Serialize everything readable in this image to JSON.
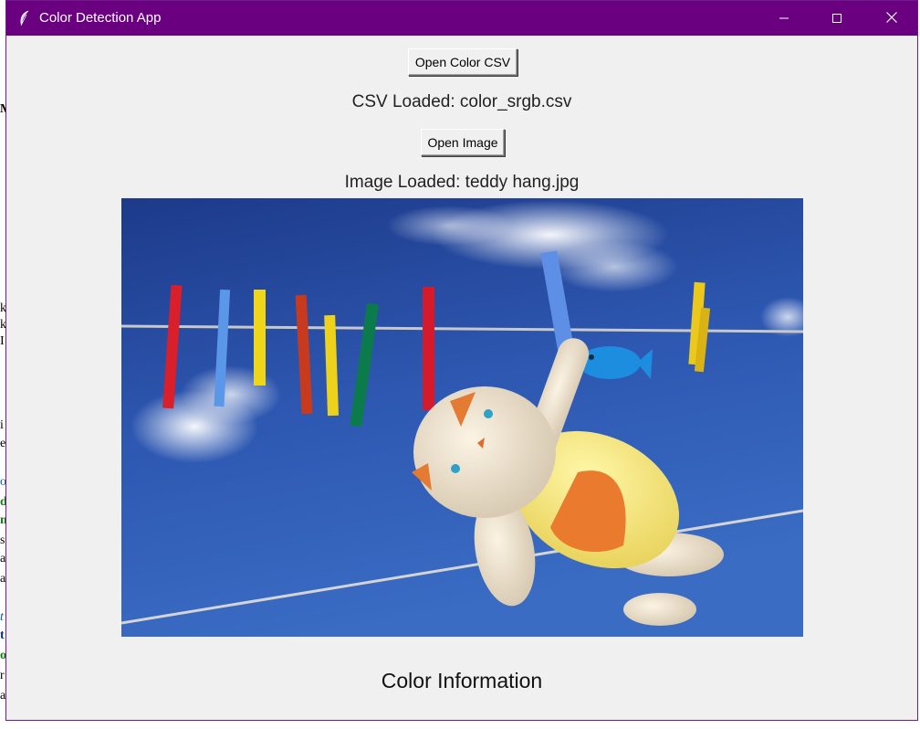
{
  "window": {
    "title": "Color Detection App",
    "titlebar_color": "#6a0080",
    "icons": {
      "app": "feather-icon",
      "minimize": "minimize-icon",
      "maximize": "maximize-icon",
      "close": "close-icon"
    }
  },
  "buttons": {
    "open_csv_label": "Open Color CSV",
    "open_image_label": "Open Image"
  },
  "status": {
    "csv": "CSV Loaded: color_srgb.csv",
    "image": "Image Loaded: teddy hang.jpg"
  },
  "color_info": {
    "heading": "Color Information"
  }
}
